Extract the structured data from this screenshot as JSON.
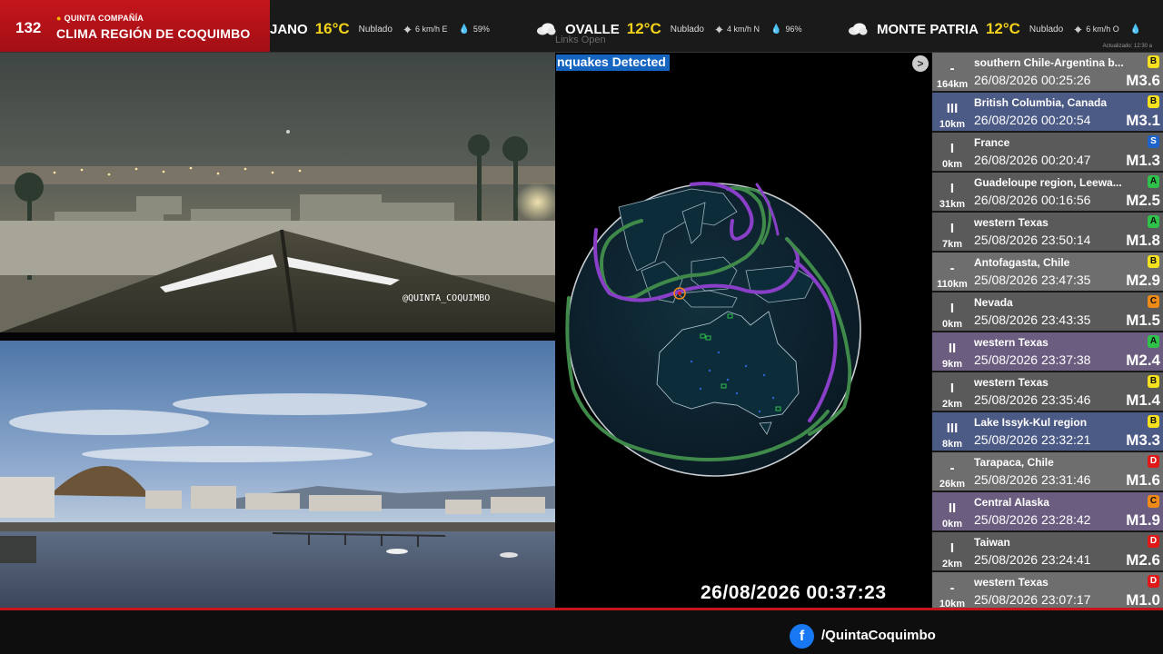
{
  "brand": {
    "number": "132",
    "subtitle": "QUINTA COMPAÑÍA",
    "title": "CLIMA REGIÓN DE COQUIMBO"
  },
  "weather": [
    {
      "name": "JANO",
      "temp": "16°C",
      "condition": "Nublado",
      "wind": "6 km/h E",
      "humidity": "59%",
      "icon": "cloud-icon"
    },
    {
      "name": "OVALLE",
      "temp": "12°C",
      "condition": "Nublado",
      "wind": "4 km/h N",
      "humidity": "96%",
      "icon": "cloud-icon"
    },
    {
      "name": "MONTE PATRIA",
      "temp": "12°C",
      "condition": "Nublado",
      "wind": "6 km/h O",
      "humidity": "",
      "icon": "cloud-icon"
    }
  ],
  "updated": "Actualizado: 12:30 a",
  "ghost_links": "Links   Open",
  "camera1": {
    "watermark": "@QUINTA_COQUIMBO"
  },
  "quake_panel": {
    "label": "nquakes Detected",
    "nav": ">",
    "clock": "26/08/2026 00:37:23"
  },
  "quakes": [
    {
      "intensity": "-",
      "depth": "164km",
      "location": "southern Chile-Argentina b...",
      "time": "26/08/2026 00:25:26",
      "magnitude": "M3.6",
      "badge": "B",
      "badge_color": "#f5e11d",
      "row_color": "#6e6e6e"
    },
    {
      "intensity": "III",
      "depth": "10km",
      "location": "British Columbia, Canada",
      "time": "26/08/2026 00:20:54",
      "magnitude": "M3.1",
      "badge": "B",
      "badge_color": "#f5e11d",
      "row_color": "#4c5a86"
    },
    {
      "intensity": "I",
      "depth": "0km",
      "location": "France",
      "time": "26/08/2026 00:20:47",
      "magnitude": "M1.3",
      "badge": "S",
      "badge_color": "#1e63c9",
      "row_color": "#5a5a5a"
    },
    {
      "intensity": "I",
      "depth": "31km",
      "location": "Guadeloupe region, Leewa...",
      "time": "26/08/2026 00:16:56",
      "magnitude": "M2.5",
      "badge": "A",
      "badge_color": "#2ec24a",
      "row_color": "#5a5a5a"
    },
    {
      "intensity": "I",
      "depth": "7km",
      "location": "western Texas",
      "time": "25/08/2026 23:50:14",
      "magnitude": "M1.8",
      "badge": "A",
      "badge_color": "#2ec24a",
      "row_color": "#5a5a5a"
    },
    {
      "intensity": "-",
      "depth": "110km",
      "location": "Antofagasta, Chile",
      "time": "25/08/2026 23:47:35",
      "magnitude": "M2.9",
      "badge": "B",
      "badge_color": "#f5e11d",
      "row_color": "#6e6e6e"
    },
    {
      "intensity": "I",
      "depth": "0km",
      "location": "Nevada",
      "time": "25/08/2026 23:43:35",
      "magnitude": "M1.5",
      "badge": "C",
      "badge_color": "#f08a16",
      "row_color": "#5a5a5a"
    },
    {
      "intensity": "II",
      "depth": "9km",
      "location": "western Texas",
      "time": "25/08/2026 23:37:38",
      "magnitude": "M2.4",
      "badge": "A",
      "badge_color": "#2ec24a",
      "row_color": "#6b5d80"
    },
    {
      "intensity": "I",
      "depth": "2km",
      "location": "western Texas",
      "time": "25/08/2026 23:35:46",
      "magnitude": "M1.4",
      "badge": "B",
      "badge_color": "#f5e11d",
      "row_color": "#5a5a5a"
    },
    {
      "intensity": "III",
      "depth": "8km",
      "location": "Lake Issyk-Kul region",
      "time": "25/08/2026 23:32:21",
      "magnitude": "M3.3",
      "badge": "B",
      "badge_color": "#f5e11d",
      "row_color": "#4c5a86"
    },
    {
      "intensity": "-",
      "depth": "26km",
      "location": "Tarapaca, Chile",
      "time": "25/08/2026 23:31:46",
      "magnitude": "M1.6",
      "badge": "D",
      "badge_color": "#e01818",
      "row_color": "#6e6e6e"
    },
    {
      "intensity": "II",
      "depth": "0km",
      "location": "Central Alaska",
      "time": "25/08/2026 23:28:42",
      "magnitude": "M1.9",
      "badge": "C",
      "badge_color": "#f08a16",
      "row_color": "#6b5d80"
    },
    {
      "intensity": "I",
      "depth": "2km",
      "location": "Taiwan",
      "time": "25/08/2026 23:24:41",
      "magnitude": "M2.6",
      "badge": "D",
      "badge_color": "#e01818",
      "row_color": "#5a5a5a"
    },
    {
      "intensity": "-",
      "depth": "10km",
      "location": "western Texas",
      "time": "25/08/2026 23:07:17",
      "magnitude": "M1.0",
      "badge": "D",
      "badge_color": "#e01818",
      "row_color": "#6e6e6e"
    }
  ],
  "footer": {
    "social_icon": "facebook-icon",
    "handle": "/QuintaCoquimbo"
  },
  "colors": {
    "brand_red": "#c4151c",
    "temp_yellow": "#f2d21b",
    "plate_purple": "#8a3fc8",
    "plate_green": "#3f8a4a"
  }
}
